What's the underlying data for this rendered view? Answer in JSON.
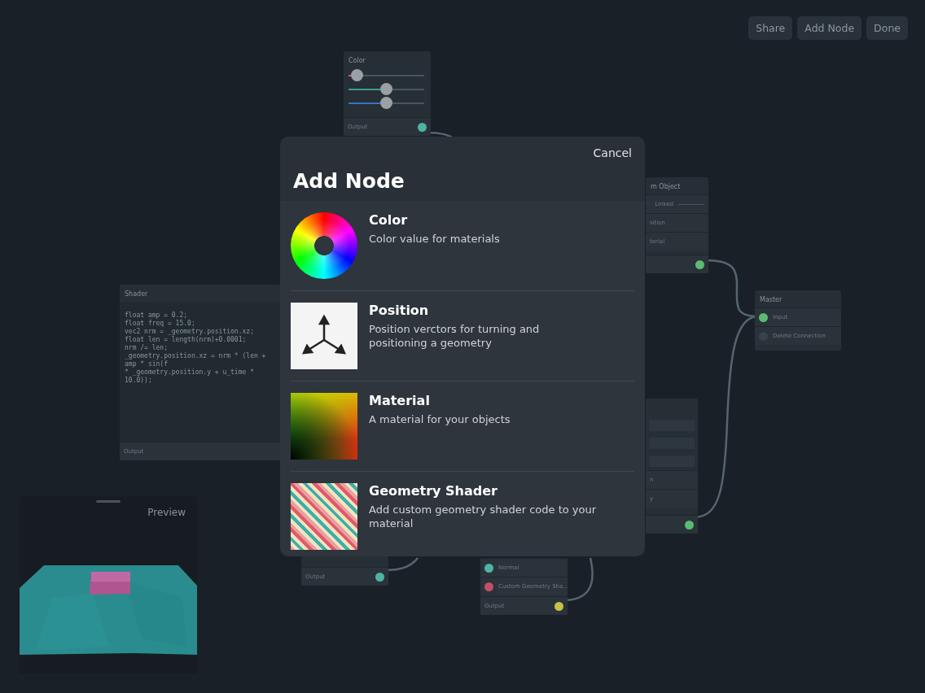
{
  "toolbar": {
    "buttons": [
      "Share",
      "Add Node",
      "Done"
    ]
  },
  "nodes": [
    {
      "title": "Color",
      "rows": [
        {
          "kind": "slider",
          "color": "#d05a5a",
          "level": 0.12
        },
        {
          "kind": "slider",
          "color": "#3aa08e",
          "level": 0.5
        },
        {
          "kind": "slider",
          "color": "#3b72c4",
          "level": 0.5
        },
        {
          "kind": "output",
          "label": "Output",
          "color": "#4fb3a3"
        }
      ]
    },
    {
      "title": "m Object",
      "rows": [
        {
          "kind": "field",
          "label": "Linked"
        },
        {
          "kind": "text",
          "label": "sition"
        },
        {
          "kind": "text",
          "label": "terial"
        },
        {
          "kind": "output",
          "color": "#5cba72"
        }
      ]
    },
    {
      "title": "Master",
      "rows": [
        {
          "kind": "input",
          "label": "Input",
          "color": "#5cba72"
        },
        {
          "kind": "input",
          "label": "Delete Connection",
          "color": "#36434c"
        }
      ]
    },
    {
      "title": "Shader",
      "rows": [
        {
          "kind": "code",
          "lines": [
            "float amp = 0.2;",
            "float freq = 15.0;",
            "vec2 nrm = _geometry.position.xz;",
            "float len = length(nrm)+0.0001;",
            "nrm /= len;",
            "_geometry.position.xz = nrm * (len + amp * sin(f",
            "* _geometry.position.y + u_time * 10.0));"
          ]
        },
        {
          "kind": "output",
          "label": "Output"
        }
      ]
    },
    {
      "rows": [
        {
          "kind": "field"
        },
        {
          "kind": "field"
        },
        {
          "kind": "field"
        },
        {
          "kind": "text",
          "label": "n"
        },
        {
          "kind": "text",
          "label": "y"
        },
        {
          "kind": "output",
          "color": "#5cba72"
        }
      ]
    },
    {
      "rows": [
        {
          "kind": "output",
          "label": "Output",
          "color": "#4fb3a3"
        }
      ]
    },
    {
      "rows": [
        {
          "kind": "input",
          "label": "Normal",
          "color": "#4fb3a3"
        },
        {
          "kind": "input",
          "label": "Custom Geometry Sha...",
          "color": "#c0506a"
        },
        {
          "kind": "output",
          "label": "Output",
          "color": "#c8c244"
        }
      ]
    }
  ],
  "preview": {
    "label": "Preview"
  },
  "dialog": {
    "cancel": "Cancel",
    "title": "Add Node",
    "items": [
      {
        "kind": "color-wheel",
        "title": "Color",
        "description": "Color value for materials"
      },
      {
        "kind": "axes",
        "title": "Position",
        "description": "Position verctors for turning and positioning a geometry"
      },
      {
        "kind": "gradient",
        "title": "Material",
        "description": "A material for your objects"
      },
      {
        "kind": "stripes",
        "title": "Geometry Shader",
        "description": "Add custom geometry shader code to your material"
      }
    ]
  }
}
